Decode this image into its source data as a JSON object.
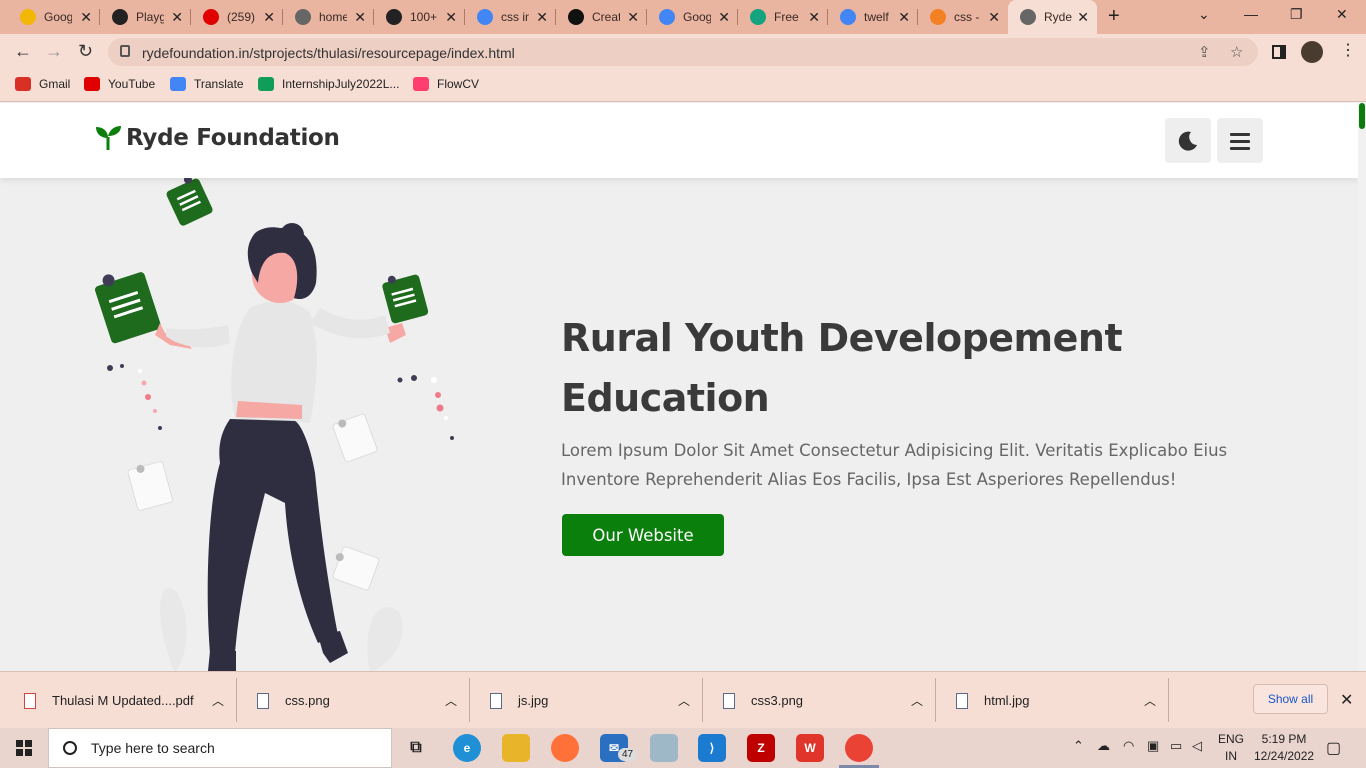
{
  "browser": {
    "tabs": [
      {
        "title": "Goog",
        "favicon": "lightbulb-icon",
        "color": "#f2b705"
      },
      {
        "title": "Playg",
        "favicon": "openai-icon",
        "color": "#222222"
      },
      {
        "title": "(259)",
        "favicon": "youtube-icon",
        "color": "#e00000"
      },
      {
        "title": "home",
        "favicon": "globe-icon",
        "color": "#666666"
      },
      {
        "title": "100+",
        "favicon": "figma-like-icon",
        "color": "#222222"
      },
      {
        "title": "css in",
        "favicon": "google-icon",
        "color": "#4285f4"
      },
      {
        "title": "Creat",
        "favicon": "f-icon",
        "color": "#111111"
      },
      {
        "title": "Goog",
        "favicon": "translate-icon",
        "color": "#4285f4"
      },
      {
        "title": "Free",
        "favicon": "grammarly-icon",
        "color": "#14a37f"
      },
      {
        "title": "twelf",
        "favicon": "google-icon",
        "color": "#4285f4"
      },
      {
        "title": "css -",
        "favicon": "stackoverflow-icon",
        "color": "#f48024"
      },
      {
        "title": "Ryde",
        "favicon": "globe-icon",
        "color": "#666666"
      }
    ],
    "new_tab": "+",
    "url": "rydefoundation.in/stprojects/thulasi/resourcepage/index.html",
    "bookmarks": [
      {
        "label": "Gmail",
        "color": "#d93025"
      },
      {
        "label": "YouTube",
        "color": "#e00000"
      },
      {
        "label": "Translate",
        "color": "#4285f4"
      },
      {
        "label": "InternshipJuly2022L...",
        "color": "#0f9d58"
      },
      {
        "label": "FlowCV",
        "color": "#ff3d6e"
      }
    ]
  },
  "site": {
    "brand": "Ryde Foundation",
    "brand_color": "#0b7f0b",
    "hero": {
      "title": "Rural Youth Developement Education",
      "text": "Lorem Ipsum Dolor Sit Amet Consectetur Adipisicing Elit. Veritatis Explicabo Eius Inventore Reprehenderit Alias Eos Facilis, Ipsa Est Asperiores Repellendus!",
      "cta": "Our Website"
    }
  },
  "downloads": {
    "items": [
      {
        "name": "Thulasi M Updated....pdf",
        "type": "pdf"
      },
      {
        "name": "css.png",
        "type": "image"
      },
      {
        "name": "js.jpg",
        "type": "image"
      },
      {
        "name": "css3.png",
        "type": "image"
      },
      {
        "name": "html.jpg",
        "type": "image"
      }
    ],
    "show_all": "Show all"
  },
  "taskbar": {
    "search_placeholder": "Type here to search",
    "mail_badge": "47",
    "lang_top": "ENG",
    "lang_bottom": "IN",
    "time": "5:19 PM",
    "date": "12/24/2022"
  }
}
